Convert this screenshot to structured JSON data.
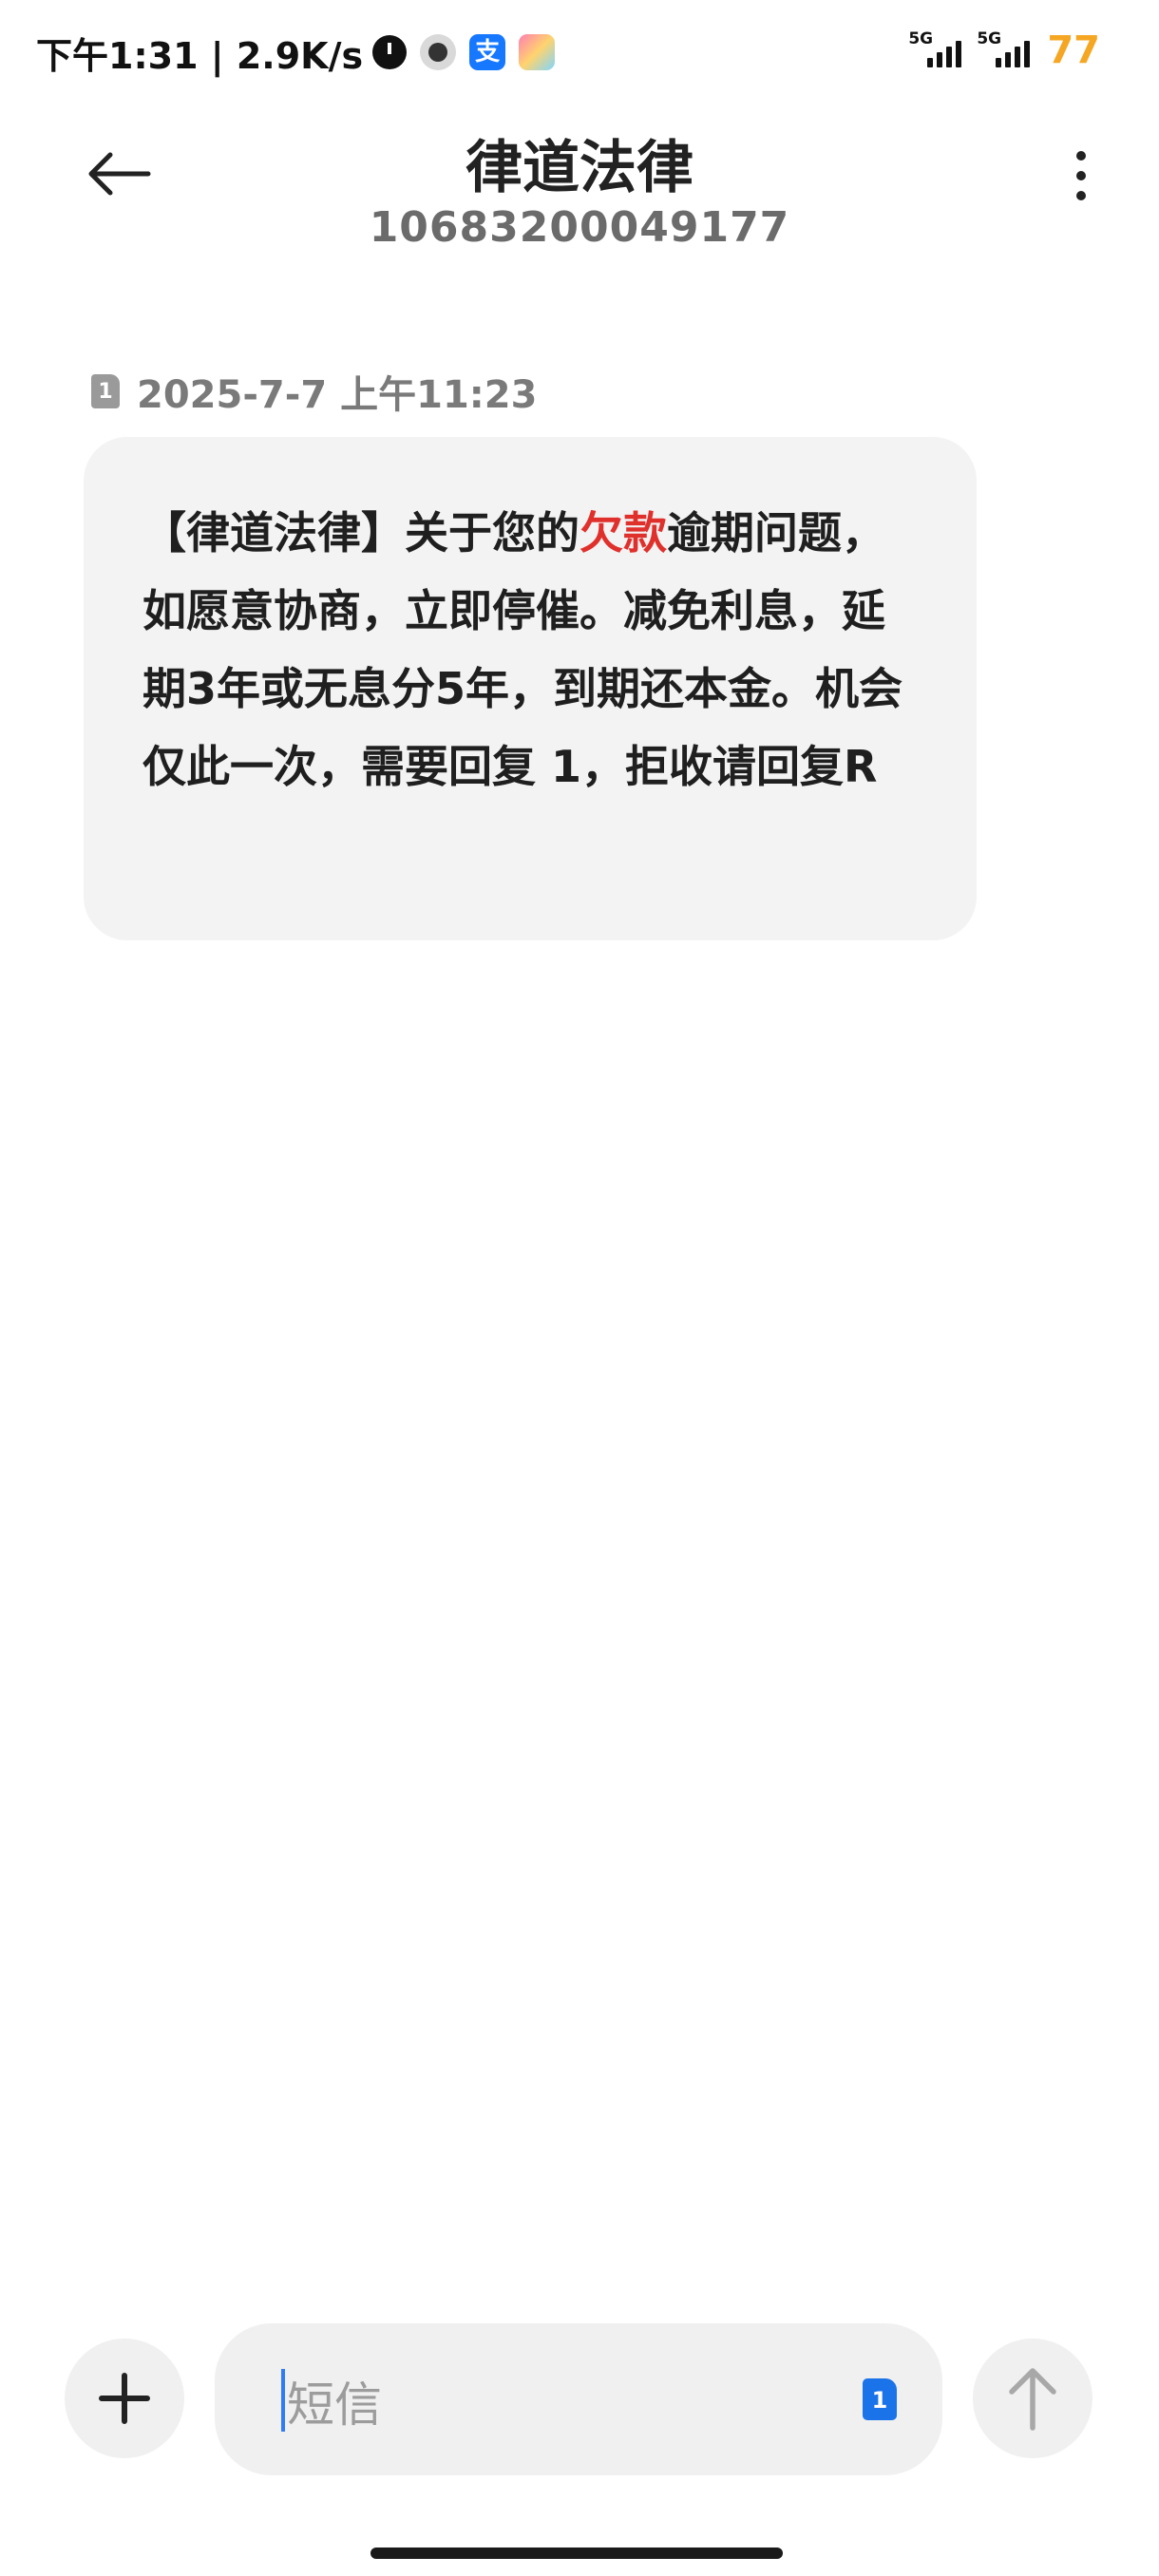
{
  "status_bar": {
    "time_speed": "下午1:31 | 2.9K/s",
    "alipay_glyph": "支",
    "net1": "5G",
    "net2": "5G",
    "battery": "77",
    "battery_color": "#f5a623"
  },
  "header": {
    "title": "律道法律",
    "number": "10683200049177"
  },
  "message": {
    "sim": "1",
    "timestamp": "2025-7-7 上午11:23",
    "text_part1": "【律道法律】关于您的",
    "text_highlight": "欠款",
    "text_part2": "逾期问题，如愿意协商，立即停催。减免利息，延期3年或无息分5年，到期还本金。机会仅此一次，需要回复 1，拒收请回复R",
    "highlight_color": "#e0302c"
  },
  "composer": {
    "placeholder": "短信",
    "sim": "1",
    "accent_color": "#1a73e8"
  }
}
